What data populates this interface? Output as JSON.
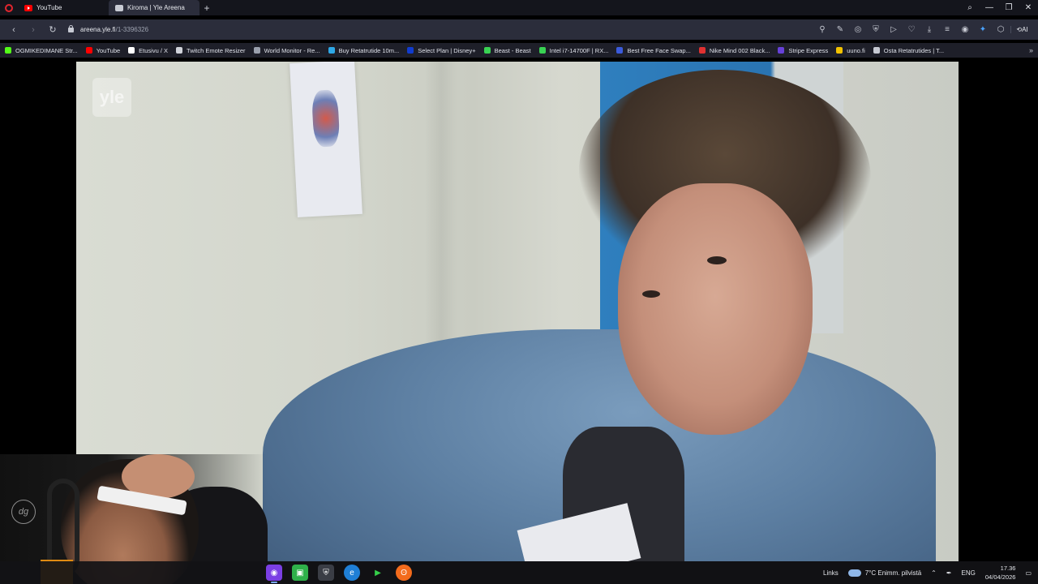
{
  "browser": {
    "tabs": [
      {
        "label": "YouTube",
        "favicon": "youtube-icon",
        "active": false
      },
      {
        "label": "Kiroma | Yle Areena",
        "favicon": "yle-icon",
        "active": true
      }
    ],
    "url": {
      "domain": "areena.yle.fi",
      "path": "/1-3396326"
    }
  },
  "bookmarks": [
    {
      "label": "OGMIKEDIMANE Str...",
      "color": "#53fc18"
    },
    {
      "label": "YouTube",
      "color": "#ff0000"
    },
    {
      "label": "Etusivu / X",
      "color": "#ffffff"
    },
    {
      "label": "Twitch Emote Resizer",
      "color": "#d0d3da"
    },
    {
      "label": "World Monitor - Re...",
      "color": "#9aa0ad"
    },
    {
      "label": "Buy Retatrutide 10m...",
      "color": "#2ea8e6"
    },
    {
      "label": "Select Plan | Disney+",
      "color": "#113ccf"
    },
    {
      "label": "Beast - Beast",
      "color": "#39d353"
    },
    {
      "label": "Intel i7-14700F | RX...",
      "color": "#39d353"
    },
    {
      "label": "Best Free Face Swap...",
      "color": "#3b5bdb"
    },
    {
      "label": "Nike Mind 002 Black...",
      "color": "#e03131"
    },
    {
      "label": "Stripe Express",
      "color": "#6741d9"
    },
    {
      "label": "uuno.fi",
      "color": "#f2c200"
    },
    {
      "label": "Osta Retatrutides | T...",
      "color": "#c7cad3"
    }
  ],
  "video": {
    "watermark": "yle"
  },
  "webcam": {
    "badge": "dg"
  },
  "taskbar": {
    "links_label": "Links",
    "weather": "7°C  Enimm. pilvistä",
    "lang": "ENG",
    "time": "17.36",
    "date": "04/04/2026"
  }
}
